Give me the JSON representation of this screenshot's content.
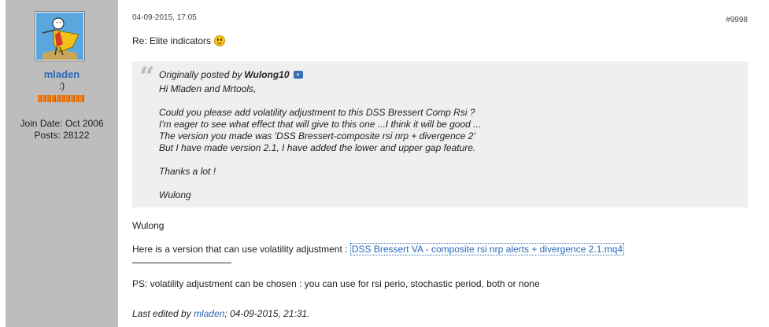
{
  "user": {
    "name": "mladen",
    "title": ":)",
    "reputation_pips": 10,
    "join_date": "Join Date: Oct 2006",
    "posts": "Posts: 28122",
    "avatar_icon": "cartoon-figure-avatar"
  },
  "post": {
    "date": "04-09-2015, 17:05",
    "number": "#9998",
    "title": "Re: Elite indicators",
    "title_icon": "smiley-icon"
  },
  "quote": {
    "prefix": "Originally posted by",
    "author": "Wulong10",
    "goto_icon": "view-post-icon",
    "lines": [
      "Hi Mladen and Mrtools,",
      "",
      "Could you please add volatility adjustment to this DSS Bressert Comp Rsi ?",
      "I'm eager to see what effect that will give to this one ...I think it will be good ...",
      "The version you made was 'DSS Bressert-composite rsi nrp + divergence 2'",
      "But I have made version 2.1, I have added the lower and upper gap feature.",
      "",
      "Thanks a lot !",
      "",
      "Wulong"
    ]
  },
  "message": {
    "greeting": "Wulong",
    "version_text": "Here is a version that can use volatility adjustment :",
    "attachment_link": "DSS Bressert VA - composite rsi nrp alerts + divergence 2.1.mq4",
    "ps": "PS: volatility adjustment can be chosen : you can use for rsi perio, stochastic period, both or none"
  },
  "edit": {
    "prefix": "Last edited by",
    "editor": "mladen",
    "suffix": "; 04-09-2015, 21:31."
  },
  "colors": {
    "sidebar_bg": "#bdbdbd",
    "link": "#2a6ab5",
    "quote_bg": "#efefef",
    "rep_pip": "#f07a10"
  }
}
